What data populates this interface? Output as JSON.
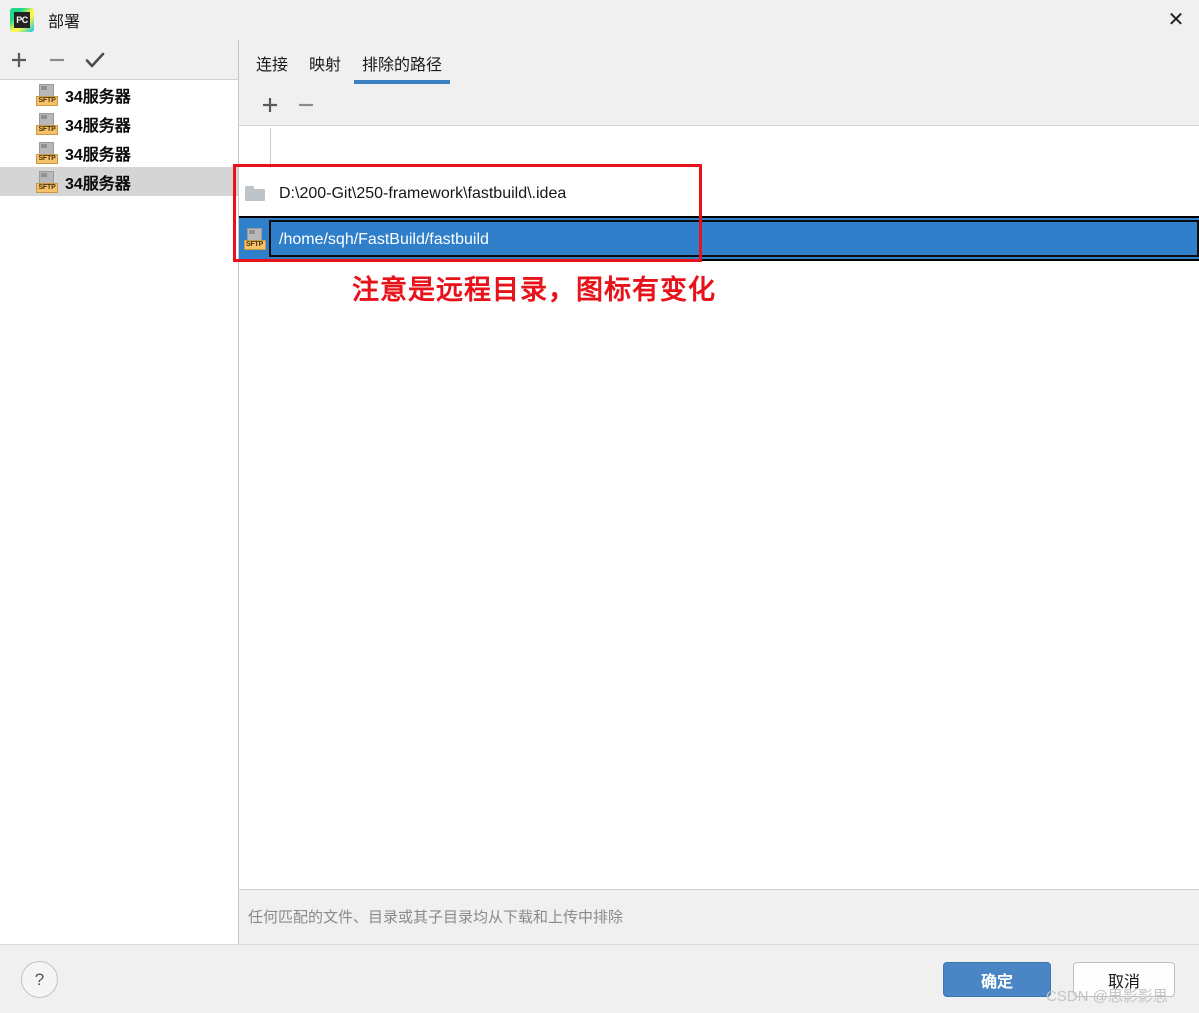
{
  "window": {
    "title": "部署",
    "app_icon": "pycharm-logo-icon",
    "app_icon_text": "PC",
    "close_label": "✕"
  },
  "sidebar": {
    "toolbar": [
      {
        "name": "add-server-button",
        "glyph": "plus-icon"
      },
      {
        "name": "remove-server-button",
        "glyph": "minus-icon"
      },
      {
        "name": "set-default-server-button",
        "glyph": "check-icon"
      }
    ],
    "items": [
      {
        "label": "34服务器",
        "icon": "sftp-icon",
        "icon_tag": "SFTP",
        "selected": false
      },
      {
        "label": "34服务器",
        "icon": "sftp-icon",
        "icon_tag": "SFTP",
        "selected": false
      },
      {
        "label": "34服务器",
        "icon": "sftp-icon",
        "icon_tag": "SFTP",
        "selected": false
      },
      {
        "label": "34服务器",
        "icon": "sftp-icon",
        "icon_tag": "SFTP",
        "selected": true
      }
    ]
  },
  "tabs": [
    {
      "label": "连接",
      "active": false
    },
    {
      "label": "映射",
      "active": false
    },
    {
      "label": "排除的路径",
      "active": true
    }
  ],
  "path_toolbar": [
    {
      "name": "add-path-button",
      "glyph": "plus-icon"
    },
    {
      "name": "remove-path-button",
      "glyph": "minus-icon"
    }
  ],
  "paths": {
    "rows": [
      {
        "value": "",
        "icon": "none",
        "selected": false
      },
      {
        "value": "D:\\200-Git\\250-framework\\fastbuild\\.idea",
        "icon": "folder-icon",
        "selected": false
      },
      {
        "value": "/home/sqh/FastBuild/fastbuild",
        "icon": "sftp-icon",
        "icon_tag": "SFTP",
        "selected": true
      }
    ]
  },
  "status": {
    "hint": "任何匹配的文件、目录或其子目录均从下载和上传中排除"
  },
  "footer": {
    "help_label": "?",
    "ok_label": "确定",
    "cancel_label": "取消"
  },
  "annotations": {
    "note_text": "注意是远程目录，图标有变化",
    "box_color": "#e8131a",
    "text_color": "#e8131a"
  },
  "watermark": {
    "text": "CSDN @思影影思"
  },
  "colors": {
    "accent_blue": "#3a7fc1",
    "selection_blue": "#2f7fcb",
    "ok_button": "#4a86c5",
    "sidebar_selected": "#d5d5d5",
    "annotation_red": "#e8131a",
    "sftp_tag": "#f5c26b"
  }
}
